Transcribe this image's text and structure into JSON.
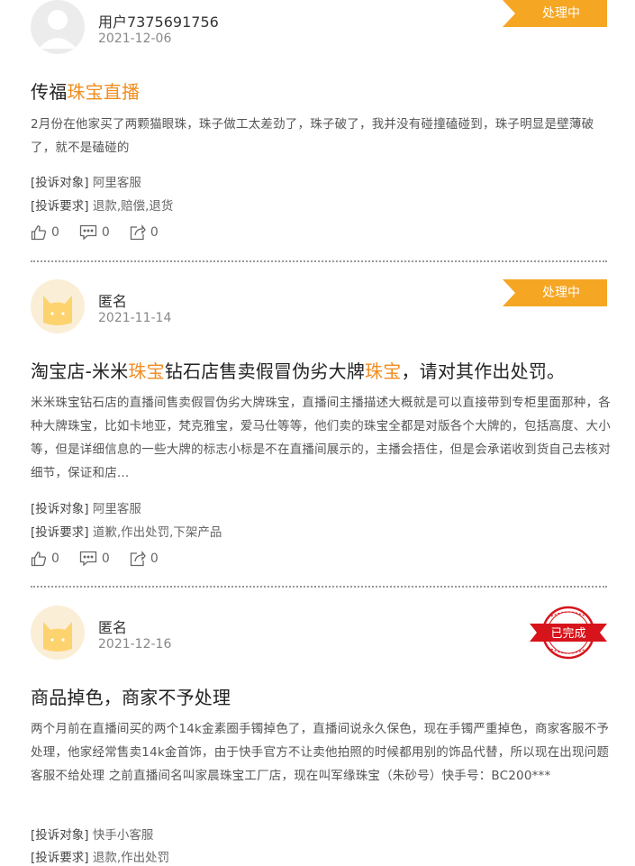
{
  "complaints": [
    {
      "user": "用户7375691756",
      "date": "2021-12-06",
      "status": "处理中",
      "avatar_type": "default-user-avatar",
      "title_parts": [
        {
          "text": "传福",
          "highlight": false
        },
        {
          "text": "珠宝直播",
          "highlight": true
        }
      ],
      "content": "2月份在他家买了两颗猫眼珠，珠子做工太差劲了，珠子破了，我并没有碰撞磕碰到，珠子明显是壁薄破了，就不是磕碰的",
      "target_label": "[投诉对象]",
      "target": "阿里客服",
      "request_label": "[投诉要求]",
      "request": "退款,赔偿,退货",
      "likes": "0",
      "comments": "0",
      "shares": "0"
    },
    {
      "user": "匿名",
      "date": "2021-11-14",
      "status": "处理中",
      "avatar_type": "cat-avatar",
      "title_parts": [
        {
          "text": "淘宝店-米米",
          "highlight": false
        },
        {
          "text": "珠宝",
          "highlight": true
        },
        {
          "text": "钻石店售卖假冒伪劣大牌",
          "highlight": false
        },
        {
          "text": "珠宝",
          "highlight": true
        },
        {
          "text": "，请对其作出处罚。",
          "highlight": false
        }
      ],
      "content": "米米珠宝钻石店的直播间售卖假冒伪劣大牌珠宝，直播间主播描述大概就是可以直接带到专柜里面那种，各种大牌珠宝，比如卡地亚，梵克雅宝，爱马仕等等，他们卖的珠宝全都是对版各个大牌的，包括高度、大小等，但是详细信息的一些大牌的标志小标是不在直播间展示的，主播会捂住，但是会承诺收到货自己去核对细节，保证和店...",
      "target_label": "[投诉对象]",
      "target": "阿里客服",
      "request_label": "[投诉要求]",
      "request": "道歉,作出处罚,下架产品",
      "likes": "0",
      "comments": "0",
      "shares": "0"
    },
    {
      "user": "匿名",
      "date": "2021-12-16",
      "status": "已完成",
      "avatar_type": "cat-avatar",
      "title_parts": [
        {
          "text": "商品掉色，商家不予处理",
          "highlight": false
        }
      ],
      "content": "两个月前在直播间买的两个14k金素圈手镯掉色了，直播间说永久保色，现在手镯严重掉色，商家客服不予处理，他家经常售卖14k金首饰，由于快手官方不让卖他拍照的时候都用别的饰品代替，所以现在出现问题客服不给处理 之前直播间名叫家晨珠宝工厂店，现在叫军缘珠宝（朱砂号）快手号：BC200***",
      "target_label": "[投诉对象]",
      "target": "快手小客服",
      "request_label": "[投诉要求]",
      "request": "退款,作出处罚"
    }
  ],
  "colors": {
    "processing": "#f5a623",
    "done": "#d7131b",
    "highlight": "#f08c1e"
  }
}
